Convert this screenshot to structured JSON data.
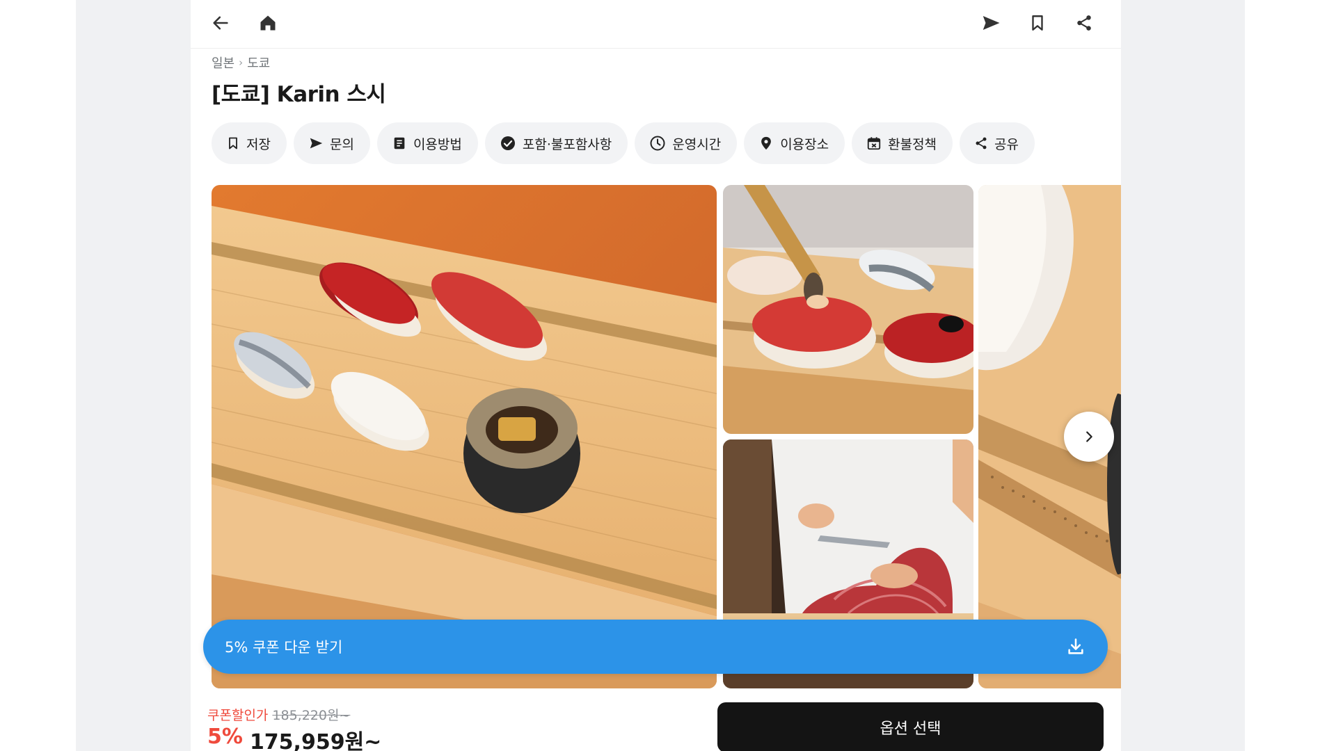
{
  "nav": {
    "back_icon": "arrow-left-icon",
    "home_icon": "home-icon",
    "send_icon": "send-icon",
    "bookmark_icon": "bookmark-icon",
    "share_icon": "share-icon"
  },
  "breadcrumb": {
    "country": "일본",
    "city": "도쿄"
  },
  "product": {
    "title": "[도쿄] Karin 스시"
  },
  "chips": [
    {
      "label": "저장",
      "icon": "bookmark-icon"
    },
    {
      "label": "문의",
      "icon": "send-icon"
    },
    {
      "label": "이용방법",
      "icon": "document-icon"
    },
    {
      "label": "포함·불포함사항",
      "icon": "check-circle-icon"
    },
    {
      "label": "운영시간",
      "icon": "clock-icon"
    },
    {
      "label": "이용장소",
      "icon": "location-pin-icon"
    },
    {
      "label": "환불정책",
      "icon": "calendar-icon"
    },
    {
      "label": "공유",
      "icon": "share-icon"
    }
  ],
  "gallery": {
    "images": [
      "sushi-platter-photo",
      "chef-brushing-nigiri-photo",
      "chef-cutting-tuna-photo",
      "squid-nigiri-closeup-photo"
    ],
    "next_icon": "chevron-right-icon"
  },
  "coupon_banner": {
    "label": "5% 쿠폰 다운 받기",
    "icon": "download-icon"
  },
  "pricing": {
    "coupon_label": "쿠폰할인가",
    "original_price": "185,220원~",
    "discount_percent": "5%",
    "final_price": "175,959원~"
  },
  "option_button": {
    "label": "옵션 선택"
  },
  "colors": {
    "accent_blue": "#2c93e8",
    "sale_red": "#ef4a3c",
    "button_black": "#141414",
    "chip_bg": "#f2f3f5"
  }
}
